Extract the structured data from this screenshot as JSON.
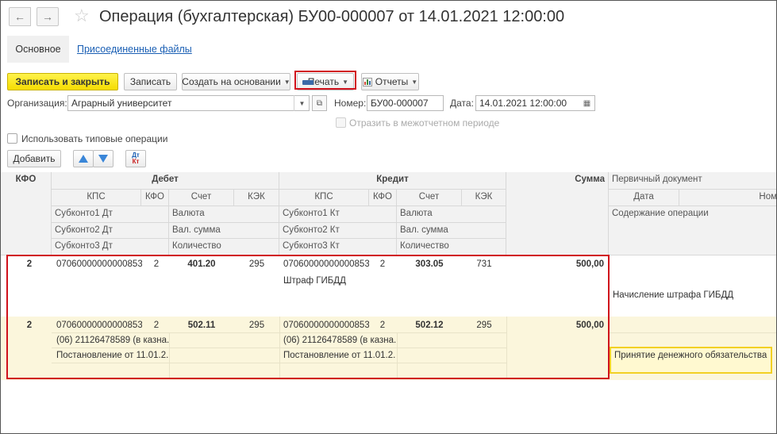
{
  "window": {
    "title": "Операция (бухгалтерская) БУ00-000007 от 14.01.2021 12:00:00"
  },
  "tabs": {
    "main": "Основное",
    "attached": "Присоединенные файлы"
  },
  "toolbar": {
    "save_close": "Записать и закрыть",
    "save": "Записать",
    "create_based": "Создать на основании",
    "print": "Печать",
    "reports": "Отчеты"
  },
  "form": {
    "org_label": "Организация:",
    "org_value": "Аграрный университет",
    "number_label": "Номер:",
    "number_value": "БУ00-000007",
    "date_label": "Дата:",
    "date_value": "14.01.2021 12:00:00",
    "reflect_label": "Отразить в межотчетном периоде",
    "typical_ops_label": "Использовать типовые операции"
  },
  "table_toolbar": {
    "add": "Добавить",
    "dt": "Дт",
    "kt": "Кт"
  },
  "table": {
    "headers": {
      "kfo": "КФО",
      "debit": "Дебет",
      "credit": "Кредит",
      "sum": "Сумма",
      "primary_doc": "Первичный документ",
      "kps": "КПС",
      "kfo2": "КФО",
      "account": "Счет",
      "kek": "КЭК",
      "date": "Дата",
      "number": "Ном",
      "sub1_dt": "Субконто1 Дт",
      "sub2_dt": "Субконто2 Дт",
      "sub3_dt": "Субконто3 Дт",
      "sub1_kt": "Субконто1 Кт",
      "sub2_kt": "Субконто2 Кт",
      "sub3_kt": "Субконто3 Кт",
      "currency": "Валюта",
      "cur_sum": "Вал. сумма",
      "quantity": "Количество",
      "content": "Содержание операции"
    },
    "rows": [
      {
        "kfo": "2",
        "dt_kps": "07060000000000853",
        "dt_kfo": "2",
        "dt_account": "401.20",
        "dt_kek": "295",
        "kt_kps": "07060000000000853",
        "kt_kfo": "2",
        "kt_account": "303.05",
        "kt_kek": "731",
        "sum": "500,00",
        "kt_sub1": "Штраф ГИБДД",
        "content": "Начисление штрафа ГИБДД"
      },
      {
        "kfo": "2",
        "dt_kps": "07060000000000853",
        "dt_kfo": "2",
        "dt_account": "502.11",
        "dt_kek": "295",
        "kt_kps": "07060000000000853",
        "kt_kfo": "2",
        "kt_account": "502.12",
        "kt_kek": "295",
        "sum": "500,00",
        "dt_sub1": "(06) 21126478589 (в казна...",
        "dt_sub2": "Постановление от 11.01.2...",
        "kt_sub1": "(06) 21126478589 (в казна...",
        "kt_sub2": "Постановление от 11.01.2...",
        "content": "Принятие денежного обязательства"
      }
    ]
  },
  "colors": {
    "primary_button": "#f5dc00",
    "highlight_border": "#d0111b",
    "selected_row": "#fbf6dc",
    "link": "#1a5fb4"
  }
}
